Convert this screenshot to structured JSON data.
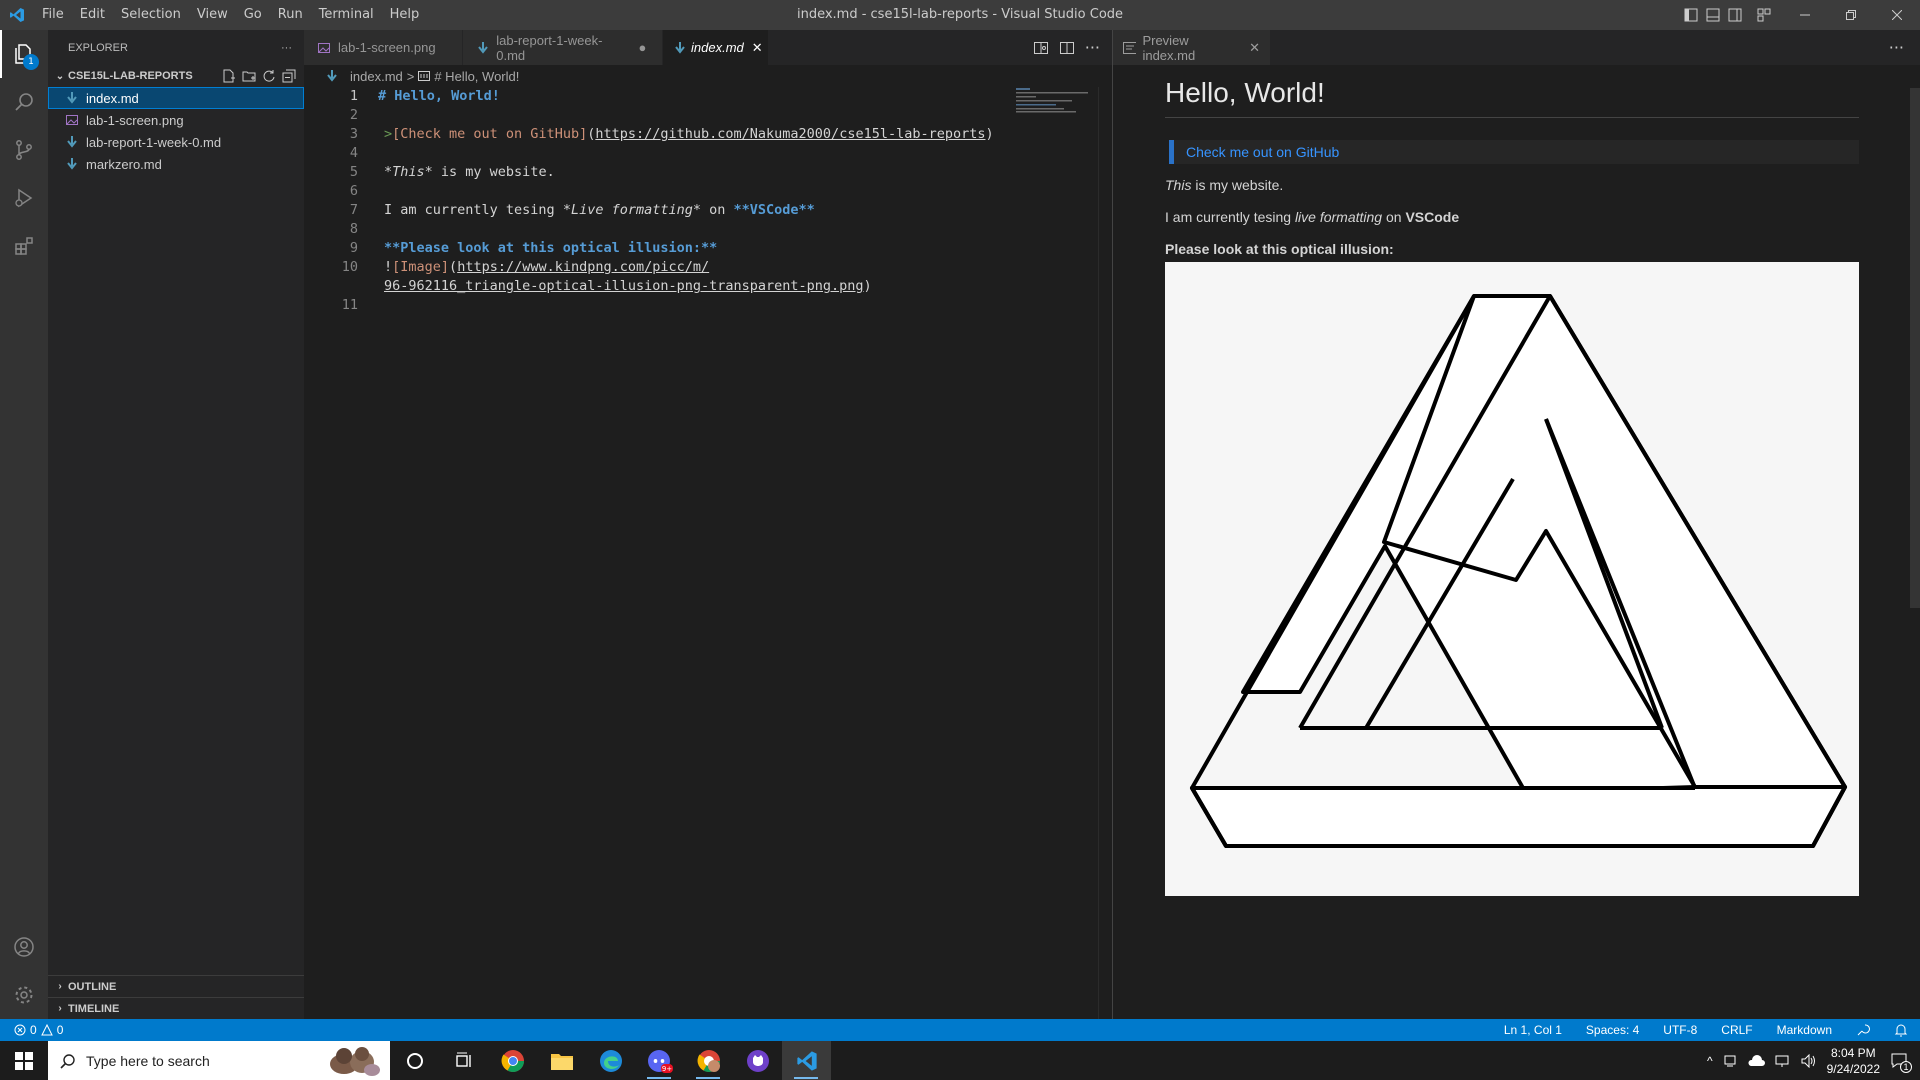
{
  "titlebar": {
    "menu": [
      "File",
      "Edit",
      "Selection",
      "View",
      "Go",
      "Run",
      "Terminal",
      "Help"
    ],
    "window_title": "index.md - cse15l-lab-reports - Visual Studio Code"
  },
  "activity": {
    "explorer_badge": "1"
  },
  "sidebar": {
    "header": "EXPLORER",
    "more": "···",
    "folder_name": "CSE15L-LAB-REPORTS",
    "files": [
      {
        "name": "index.md",
        "icon": "markdown-icon"
      },
      {
        "name": "lab-1-screen.png",
        "icon": "image-file-icon"
      },
      {
        "name": "lab-report-1-week-0.md",
        "icon": "markdown-icon"
      },
      {
        "name": "markzero.md",
        "icon": "markdown-icon"
      }
    ],
    "outline_label": "OUTLINE",
    "timeline_label": "TIMELINE"
  },
  "editor": {
    "tabs": [
      {
        "label": "lab-1-screen.png",
        "state": "closed"
      },
      {
        "label": "lab-report-1-week-0.md",
        "state": "dirty"
      },
      {
        "label": "index.md",
        "state": "active"
      }
    ],
    "breadcrumb": {
      "file": "index.md",
      "sep": ">",
      "symbol": "# Hello, World!"
    },
    "lines": {
      "n1": "1",
      "n2": "2",
      "n3": "3",
      "n4": "4",
      "n5": "5",
      "n6": "6",
      "n7": "7",
      "n8": "8",
      "n9": "9",
      "n10": "10",
      "n11": "11",
      "l1": "# Hello, World!",
      "l3_gt": ">",
      "l3_link_text": "[Check me out on GitHub]",
      "l3_open": "(",
      "l3_url": "https://github.com/Nakuma2000/cse15l-lab-reports",
      "l3_close": ")",
      "l5_em": "*This*",
      "l5_rest": " is my website.",
      "l7_a": "I am currently tesing ",
      "l7_em": "*Live formatting*",
      "l7_b": " on ",
      "l7_bold": "**VSCode**",
      "l9": "**Please look at this optical illusion:**",
      "l10_bang": "!",
      "l10_alt": "[Image]",
      "l10_open": "(",
      "l10_url_a": "https://www.kindpng.com/picc/m/",
      "l10_url_b": "96-962116_triangle-optical-illusion-png-transparent-png.png",
      "l10_close": ")"
    }
  },
  "preview": {
    "tab_label": "Preview index.md",
    "heading": "Hello, World!",
    "quote_link": "Check me out on GitHub",
    "p1_em": "This",
    "p1_rest": " is my website.",
    "p2_a": "I am currently tesing ",
    "p2_em": "live formatting",
    "p2_b": " on ",
    "p2_bold": "VSCode",
    "p3_bold": "Please look at this optical illusion:"
  },
  "statusbar": {
    "errors": "0",
    "warnings": "0",
    "position": "Ln 1, Col 1",
    "spaces": "Spaces: 4",
    "encoding": "UTF-8",
    "eol": "CRLF",
    "language": "Markdown"
  },
  "taskbar": {
    "search_placeholder": "Type here to search",
    "time": "8:04 PM",
    "date": "9/24/2022",
    "notifications": "1"
  },
  "colors": {
    "accent": "#007acc",
    "heading_blue": "#569cd6",
    "link_orange": "#ce9178",
    "preview_link": "#3794ff"
  }
}
